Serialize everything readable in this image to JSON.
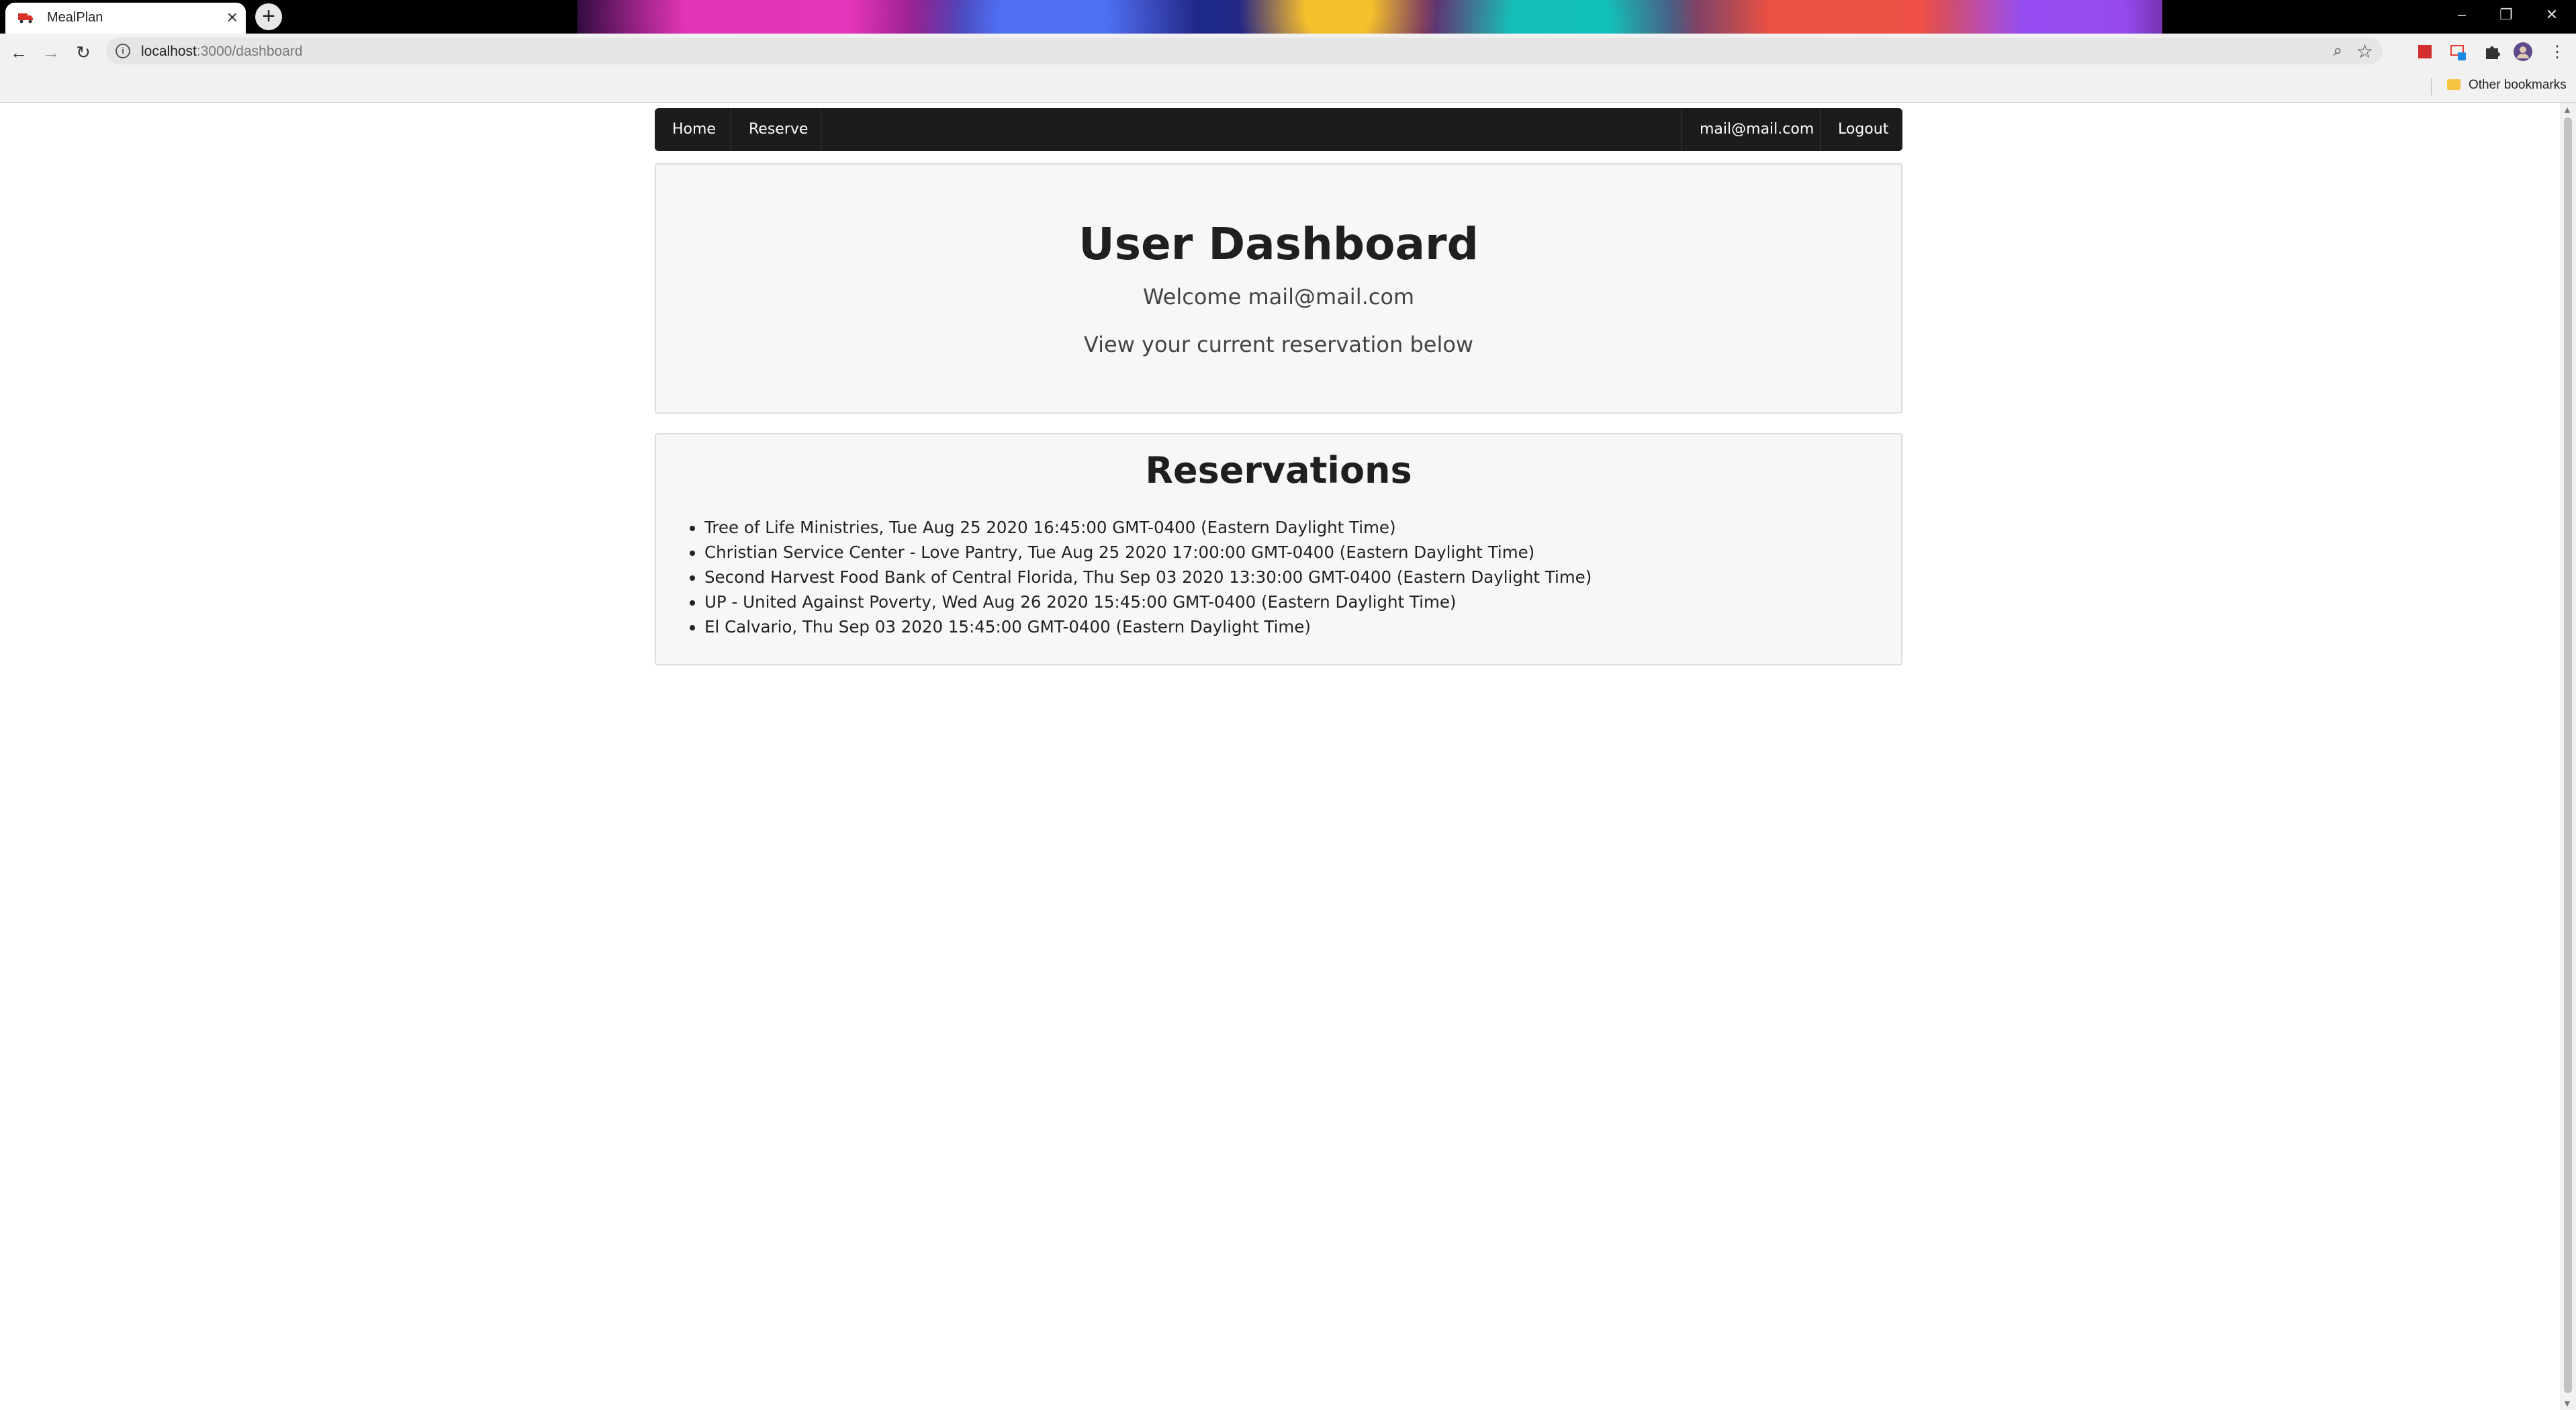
{
  "browser": {
    "tab_title": "MealPlan",
    "url_host": "localhost",
    "url_rest": ":3000/dashboard",
    "other_bookmarks": "Other bookmarks"
  },
  "nav": {
    "home": "Home",
    "reserve": "Reserve",
    "user_email": "mail@mail.com",
    "logout": "Logout"
  },
  "dashboard": {
    "title": "User Dashboard",
    "welcome": "Welcome mail@mail.com",
    "subtitle": "View your current reservation below"
  },
  "reservations": {
    "title": "Reservations",
    "items": [
      "Tree of Life Ministries, Tue Aug 25 2020 16:45:00 GMT-0400 (Eastern Daylight Time)",
      "Christian Service Center - Love Pantry, Tue Aug 25 2020 17:00:00 GMT-0400 (Eastern Daylight Time)",
      "Second Harvest Food Bank of Central Florida, Thu Sep 03 2020 13:30:00 GMT-0400 (Eastern Daylight Time)",
      "UP - United Against Poverty, Wed Aug 26 2020 15:45:00 GMT-0400 (Eastern Daylight Time)",
      "El Calvario, Thu Sep 03 2020 15:45:00 GMT-0400 (Eastern Daylight Time)"
    ]
  },
  "colors": {
    "navbar_bg": "#1b1c1d",
    "segment_bg": "#f7f7f7",
    "segment_border": "#dcdcdc"
  }
}
